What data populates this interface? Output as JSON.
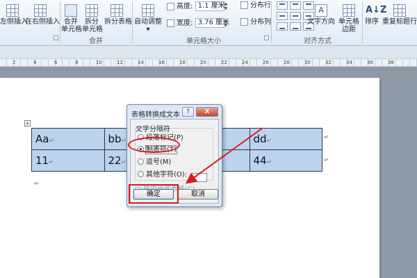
{
  "ribbon": {
    "insert_left_label": "左侧插入",
    "insert_left_prefix": "在",
    "insert_right_label": "在右侧插入",
    "merge_cells_label": [
      "合并",
      "单元格"
    ],
    "split_cells_label": [
      "拆分",
      "单元格"
    ],
    "split_table_label": "拆分表格",
    "merge_group_title": "合并",
    "autofit_label": "自动调整",
    "height_label": "高度:",
    "height_value": "1.1 厘米",
    "width_label": "宽度:",
    "width_value": "3.76 厘米",
    "distribute_rows_label": "分布行",
    "distribute_cols_label": "分布列",
    "cell_size_group_title": "单元格大小",
    "alignment_group_title": "对齐方式",
    "text_direction_label": "文字方向",
    "cell_margins_label": [
      "单元格",
      "边距"
    ],
    "sort_label": "排序",
    "repeat_header_label": "重复标题行",
    "sort_icon_text": "A↓Z"
  },
  "ruler": {
    "numbers": [
      "2",
      "4",
      "6",
      "8",
      "10",
      "12",
      "14",
      "16",
      "18",
      "20",
      "22",
      "24",
      "26",
      "28",
      "30",
      "32",
      "34",
      "36",
      "38"
    ]
  },
  "document": {
    "move_handle": "+",
    "table": {
      "rows": [
        [
          "Aa",
          "bb",
          "",
          "dd"
        ],
        [
          "11",
          "22",
          "",
          "44"
        ]
      ]
    },
    "para_mark": "↵"
  },
  "dialog": {
    "title": "表格转换成文本",
    "help_button": "?",
    "close_button": "X",
    "separator_legend": "文字分隔符",
    "options": [
      {
        "label": "段落标记(P)",
        "selected": false
      },
      {
        "label": "制表符(T)",
        "selected": true
      },
      {
        "label": "逗号(M)",
        "selected": false
      },
      {
        "label": "其他字符(O):",
        "selected": false
      }
    ],
    "other_char_value": "-",
    "nested_checkbox_label": "转换嵌套表格(C)",
    "nested_checkbox_checked": true,
    "ok_button": "确定",
    "cancel_button": "取消"
  },
  "annotation": {
    "color": "#d8191b"
  }
}
